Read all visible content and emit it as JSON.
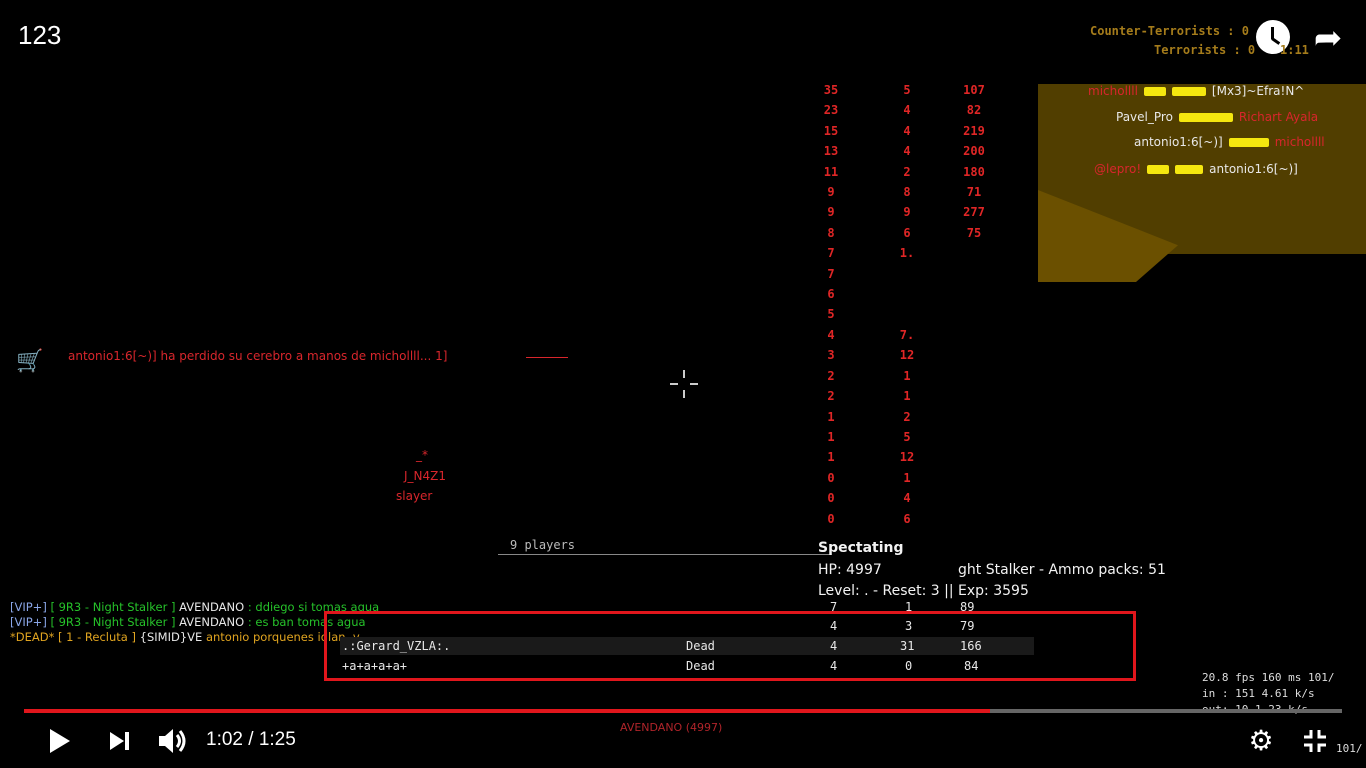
{
  "video": {
    "title": "123",
    "time_current": "1:02",
    "time_total": "1:25",
    "time_separator": "/",
    "progress": 0.733,
    "icons": [
      "watch-later-icon",
      "share-icon",
      "play-icon",
      "next-icon",
      "volume-icon",
      "settings-icon",
      "exit-fullscreen-icon"
    ]
  },
  "hud": {
    "ct_score": "Counter-Terrorists : 0",
    "t_score": "Terrorists : 0",
    "round_timer": "1:11",
    "kill_feed": [
      {
        "killer": "michollll",
        "victim": "[Mx3]~Efra!N^"
      },
      {
        "killer": "Pavel_Pro",
        "victim": "Richart Ayala"
      },
      {
        "killer": "antonio1:6[~)]",
        "victim": "michollll"
      },
      {
        "killer": "@lepro!",
        "victim": "antonio1:6[~)]"
      }
    ],
    "stats_col1": [
      "35",
      "23",
      "15",
      "13",
      "11",
      "9",
      "9",
      "8",
      "7",
      "7",
      "6",
      "5",
      "4",
      "3",
      "2",
      "2",
      "1",
      "1",
      "1",
      "0",
      "0",
      "0"
    ],
    "stats_col2": [
      "5",
      "4",
      "4",
      "4",
      "2",
      "8",
      "9",
      "6",
      "1.",
      "",
      "",
      "",
      "7.",
      "12",
      "1",
      "1",
      "2",
      "5",
      "12",
      "1",
      "4",
      "6"
    ],
    "stats_col3": [
      "107",
      "82",
      "219",
      "200",
      "180",
      "71",
      "277",
      "75",
      "",
      "",
      "",
      "",
      "",
      "",
      "",
      "",
      "",
      "",
      "",
      "",
      "",
      ""
    ],
    "kill_message": "antonio1:6[~)] ha perdido su cerebro a manos de michollll...",
    "kill_message_suffix": "1]",
    "player_tags": [
      "_*",
      "J_N4Z1",
      "slayer"
    ],
    "players_count": "9 players",
    "spectating": "Spectating",
    "hp_line": "HP: 4997",
    "hp_extra": "ght Stalker - Ammo packs: 51",
    "level_line": "Level: . - Reset: 3 || Exp: 3595",
    "spectated_player": "AVENDANO (4997)"
  },
  "chat": [
    {
      "prefix": "[VIP+]",
      "tag": "[ 9R3 - Night Stalker ]",
      "name": "AVENDANO",
      "msg": ": ddiego si tomas agua"
    },
    {
      "prefix": "[VIP+]",
      "tag": "[ 9R3 - Night Stalker ]",
      "name": "AVENDANO",
      "msg": ": es ban    tomas agua"
    },
    {
      "prefix": "*DEAD*",
      "tag": "[ 1 - Recluta ]",
      "name": "{SIMID}VE",
      "msg": "antonio porquenes idlan .v"
    }
  ],
  "scoreboard": {
    "rows": [
      {
        "name": "",
        "status": "",
        "c1": "7",
        "c2": "1",
        "c3": "89"
      },
      {
        "name": "",
        "status": "",
        "c1": "4",
        "c2": "3",
        "c3": "79"
      },
      {
        "name": ".:Gerard_VZLA:.",
        "status": "Dead",
        "c1": "4",
        "c2": "31",
        "c3": "166"
      },
      {
        "name": "+a+a+a+a+",
        "status": "Dead",
        "c1": "4",
        "c2": "0",
        "c3": "84"
      }
    ]
  },
  "netgraph": {
    "fps_line": "20.8 fps   160 ms 101/",
    "in_line": "in :  151 4.61 k/s",
    "out_line": "out:  10 1.23 k/s",
    "rate": "101/"
  }
}
